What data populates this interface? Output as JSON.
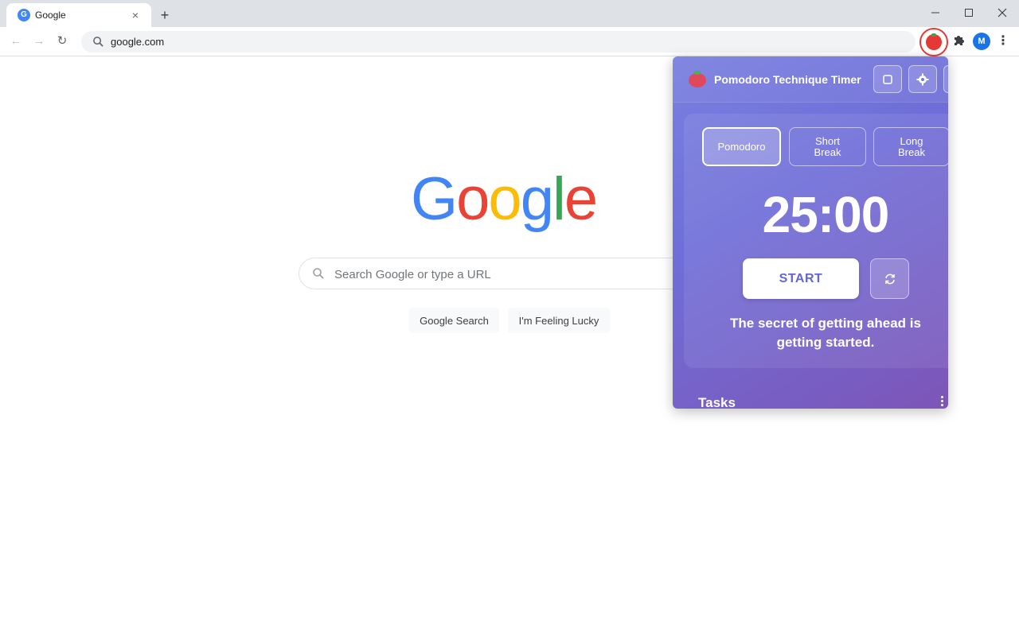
{
  "browser": {
    "tab": {
      "title": "Google",
      "favicon_letter": "G",
      "close": "×"
    },
    "new_tab": "+",
    "window_controls": {
      "minimize": "—",
      "maximize": "☐",
      "close": "✕"
    },
    "nav": {
      "back": "←",
      "forward": "→",
      "reload": "↻"
    },
    "omnibox": {
      "url": "google.com"
    },
    "profile": {
      "initial": "M"
    },
    "menu": "⋮"
  },
  "google": {
    "logo_letters": [
      {
        "char": "G",
        "color": "#4285f4"
      },
      {
        "char": "o",
        "color": "#ea4335"
      },
      {
        "char": "o",
        "color": "#fbbc05"
      },
      {
        "char": "g",
        "color": "#4285f4"
      },
      {
        "char": "l",
        "color": "#34a853"
      },
      {
        "char": "e",
        "color": "#ea4335"
      }
    ],
    "search_placeholder": "Search Google or type a URL",
    "buttons": {
      "search": "Google Search",
      "lucky": "I'm Feeling Lucky"
    }
  },
  "pomodoro": {
    "title": "Pomodoro Technique Timer",
    "modes": [
      {
        "label": "Pomodoro",
        "active": true
      },
      {
        "label": "Short Break",
        "active": false
      },
      {
        "label": "Long Break",
        "active": false
      }
    ],
    "timer": "25:00",
    "start_label": "START",
    "quote": "The secret of getting ahead is getting started.",
    "tasks_label": "Tasks",
    "accent_color": "#6366d8"
  }
}
